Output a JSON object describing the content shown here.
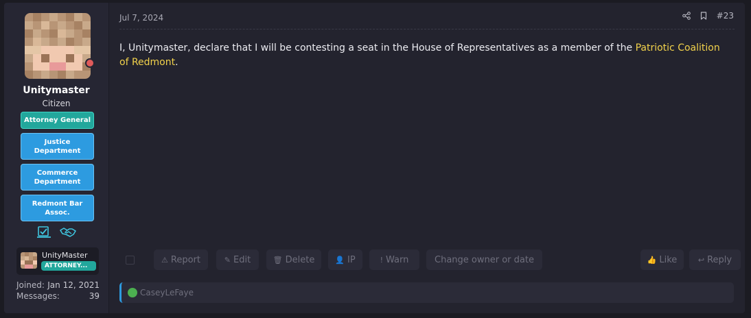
{
  "user": {
    "name": "Unitymaster",
    "title": "Citizen",
    "banners": [
      "Attorney General",
      "Justice Department",
      "Commerce Department",
      "Redmont Bar Assoc."
    ],
    "badge_icons": [
      "checklist-icon",
      "handshake-icon"
    ],
    "mini_card": {
      "name": "UnityMaster",
      "role": "ATTORNEY..."
    },
    "stats": [
      {
        "label": "Joined:",
        "value": "Jan 12, 2021"
      },
      {
        "label": "Messages:",
        "value": "39"
      }
    ]
  },
  "post": {
    "date": "Jul 7, 2024",
    "number": "#23",
    "message_before": "I, Unitymaster, declare that I will be contesting a seat in the House of Representatives as a member of the ",
    "message_highlight": "Patriotic Coalition of Redmont",
    "message_after": ".",
    "highlight_color": "#f2d24b",
    "actions": {
      "report": "Report",
      "edit": "Edit",
      "delete": "Delete",
      "ip": "IP",
      "warn": "Warn",
      "change_owner": "Change owner or date",
      "like": "Like",
      "reply": "Reply"
    },
    "reply_user": "CaseyLeFaye"
  },
  "colors": {
    "accent_teal": "#22a79c",
    "accent_blue": "#2d9be0",
    "status_offline": "#e05b5b"
  }
}
